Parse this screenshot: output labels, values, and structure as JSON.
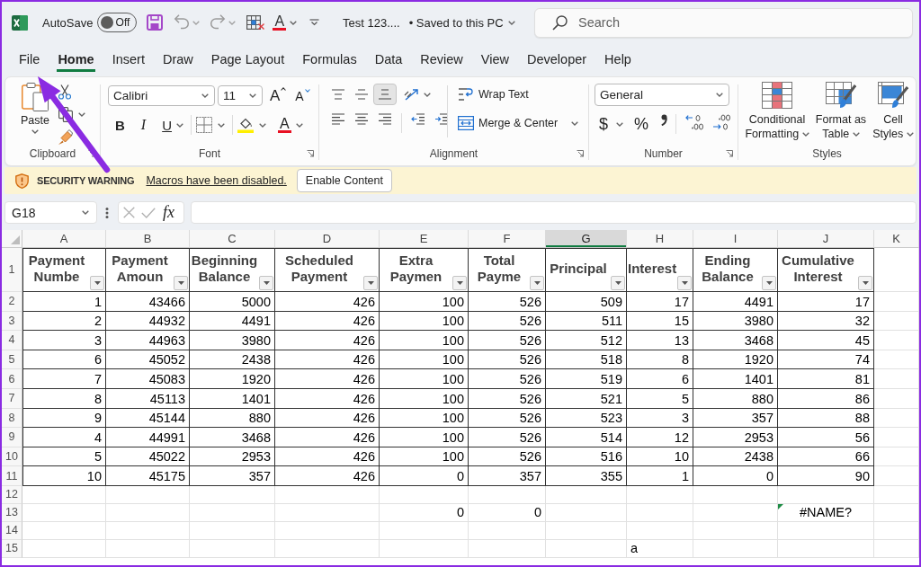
{
  "title_bar": {
    "autosave": {
      "label": "AutoSave",
      "toggle_text": "Off",
      "on": false
    },
    "quick_access": {
      "font_color": "A"
    },
    "document": {
      "name": "Test 123....",
      "status": "• Saved to this PC"
    },
    "search": {
      "placeholder": "Search"
    }
  },
  "tabs": [
    {
      "label": "File",
      "selected": false
    },
    {
      "label": "Home",
      "selected": true
    },
    {
      "label": "Insert",
      "selected": false
    },
    {
      "label": "Draw",
      "selected": false
    },
    {
      "label": "Page Layout",
      "selected": false
    },
    {
      "label": "Formulas",
      "selected": false
    },
    {
      "label": "Data",
      "selected": false
    },
    {
      "label": "Review",
      "selected": false
    },
    {
      "label": "View",
      "selected": false
    },
    {
      "label": "Developer",
      "selected": false
    },
    {
      "label": "Help",
      "selected": false
    }
  ],
  "ribbon": {
    "clipboard": {
      "paste": "Paste",
      "label": "Clipboard"
    },
    "font": {
      "font_name": "Calibri",
      "font_size": "11",
      "grow": "A",
      "shrink": "A",
      "bold": "B",
      "italic": "I",
      "underline": "U",
      "font_color": "A",
      "label": "Font"
    },
    "alignment": {
      "vertical": [
        {
          "kind": "top",
          "selected": false
        },
        {
          "kind": "middle",
          "selected": false
        },
        {
          "kind": "bottom",
          "selected": true
        }
      ],
      "wrap_text": "Wrap Text",
      "merge": "Merge & Center",
      "label": "Alignment"
    },
    "number": {
      "format": "General",
      "currency": "$",
      "percent": "%",
      "label": "Number"
    },
    "styles": {
      "buttons": [
        {
          "kind": "conditional",
          "label": "Conditional Formatting"
        },
        {
          "kind": "table",
          "label": "Format as Table"
        },
        {
          "kind": "cell",
          "label": "Cell Styles"
        }
      ],
      "label": "Styles"
    }
  },
  "message_bar": {
    "title": "SECURITY WARNING",
    "message": "Macros have been disabled.",
    "button": "Enable Content"
  },
  "formula_bar": {
    "name_box": "G18",
    "function_label": "fx"
  },
  "sheet": {
    "columns": [
      {
        "label": "A",
        "selected": false
      },
      {
        "label": "B",
        "selected": false
      },
      {
        "label": "C",
        "selected": false
      },
      {
        "label": "D",
        "selected": false
      },
      {
        "label": "E",
        "selected": false
      },
      {
        "label": "F",
        "selected": false
      },
      {
        "label": "G",
        "selected": true
      },
      {
        "label": "H",
        "selected": false
      },
      {
        "label": "I",
        "selected": false
      },
      {
        "label": "J",
        "selected": false
      },
      {
        "label": "K",
        "selected": false
      }
    ],
    "table": {
      "number": "1",
      "headers": [
        "Payment Numbe",
        "Payment Amoun",
        "Beginning Balance",
        "Scheduled Payment",
        "Extra Paymen",
        "Total Payme",
        "Principal",
        "Interest",
        "Ending Balance",
        "Cumulative Interest"
      ],
      "rows": [
        {
          "number": "2",
          "cells": [
            "1",
            "43466",
            "5000",
            "426",
            "100",
            "526",
            "509",
            "17",
            "4491",
            "17"
          ]
        },
        {
          "number": "3",
          "cells": [
            "2",
            "44932",
            "4491",
            "426",
            "100",
            "526",
            "511",
            "15",
            "3980",
            "32"
          ]
        },
        {
          "number": "4",
          "cells": [
            "3",
            "44963",
            "3980",
            "426",
            "100",
            "526",
            "512",
            "13",
            "3468",
            "45"
          ]
        },
        {
          "number": "5",
          "cells": [
            "6",
            "45052",
            "2438",
            "426",
            "100",
            "526",
            "518",
            "8",
            "1920",
            "74"
          ]
        },
        {
          "number": "6",
          "cells": [
            "7",
            "45083",
            "1920",
            "426",
            "100",
            "526",
            "519",
            "6",
            "1401",
            "81"
          ]
        },
        {
          "number": "7",
          "cells": [
            "8",
            "45113",
            "1401",
            "426",
            "100",
            "526",
            "521",
            "5",
            "880",
            "86"
          ]
        },
        {
          "number": "8",
          "cells": [
            "9",
            "45144",
            "880",
            "426",
            "100",
            "526",
            "523",
            "3",
            "357",
            "88"
          ]
        },
        {
          "number": "9",
          "cells": [
            "4",
            "44991",
            "3468",
            "426",
            "100",
            "526",
            "514",
            "12",
            "2953",
            "56"
          ]
        },
        {
          "number": "10",
          "cells": [
            "5",
            "45022",
            "2953",
            "426",
            "100",
            "526",
            "516",
            "10",
            "2438",
            "66"
          ]
        },
        {
          "number": "11",
          "cells": [
            "10",
            "45175",
            "357",
            "426",
            "0",
            "357",
            "355",
            "1",
            "0",
            "90"
          ]
        }
      ]
    },
    "rows_below": [
      {
        "number": "12"
      },
      {
        "number": "13",
        "cells": [
          null,
          null,
          null,
          null,
          {
            "kind": "number",
            "value": "0"
          },
          {
            "kind": "number",
            "value": "0"
          },
          null,
          null,
          null,
          {
            "kind": "error",
            "value": "#NAME?"
          }
        ]
      },
      {
        "number": "14"
      },
      {
        "number": "15",
        "cells": [
          null,
          null,
          null,
          null,
          null,
          null,
          null,
          {
            "kind": "text",
            "value": "a"
          }
        ]
      }
    ]
  }
}
